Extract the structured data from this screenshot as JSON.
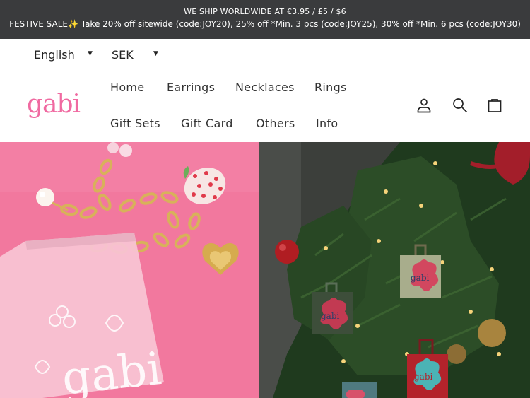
{
  "announcement": {
    "line1": "WE SHIP WORLDWIDE AT €3.95 / £5 / $6",
    "line2": "FESTIVE SALE✨ Take 20% off sitewide (code:JOY20), 25% off *Min. 3 pcs (code:JOY25), 30% off *Min. 6 pcs (code:JOY30)"
  },
  "selectors": {
    "language": "English",
    "currency": "SEK"
  },
  "logo": "gabi",
  "nav": {
    "items": [
      "Home",
      "Earrings",
      "Necklaces",
      "Rings",
      "Gift Sets",
      "Gift Card",
      "Others",
      "Info"
    ]
  },
  "icons": {
    "account": "user-icon",
    "search": "search-icon",
    "cart": "bag-icon"
  },
  "colors": {
    "announcement_bg": "#3a3b3d",
    "brand_pink": "#f06aa1",
    "hero_left_bg": "#f2789e",
    "hero_right_bg": "#3a3d38"
  },
  "hero": {
    "left_print": "gabi",
    "tag_print": "gabi"
  }
}
